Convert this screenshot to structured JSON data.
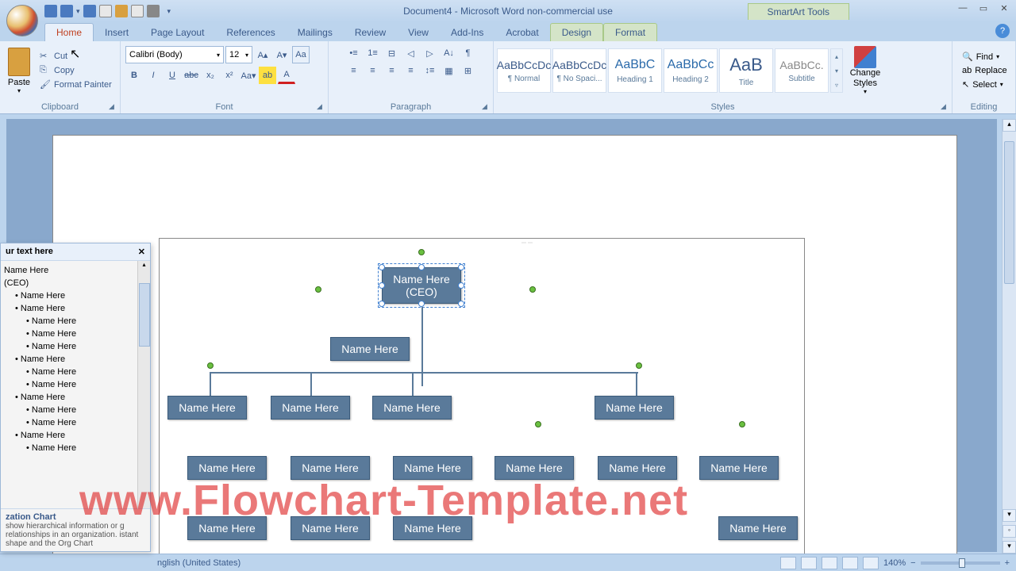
{
  "app": {
    "title": "Document4 - Microsoft Word non-commercial use",
    "contextual_tools": "SmartArt Tools"
  },
  "tabs": [
    "Home",
    "Insert",
    "Page Layout",
    "References",
    "Mailings",
    "Review",
    "View",
    "Add-Ins",
    "Acrobat",
    "Design",
    "Format"
  ],
  "active_tab": "Home",
  "clipboard": {
    "paste": "Paste",
    "cut": "Cut",
    "copy": "Copy",
    "format_painter": "Format Painter",
    "group": "Clipboard"
  },
  "font": {
    "name": "Calibri (Body)",
    "size": "12",
    "group": "Font"
  },
  "paragraph": {
    "group": "Paragraph"
  },
  "styles": {
    "items": [
      {
        "preview": "AaBbCcDc",
        "name": "¶ Normal"
      },
      {
        "preview": "AaBbCcDc",
        "name": "¶ No Spaci..."
      },
      {
        "preview": "AaBbC",
        "name": "Heading 1"
      },
      {
        "preview": "AaBbCc",
        "name": "Heading 2"
      },
      {
        "preview": "AaB",
        "name": "Title"
      },
      {
        "preview": "AaBbCc.",
        "name": "Subtitle"
      }
    ],
    "change": "Change Styles",
    "group": "Styles"
  },
  "editing": {
    "find": "Find",
    "replace": "Replace",
    "select": "Select",
    "group": "Editing"
  },
  "text_pane": {
    "title": "ur text here",
    "items": [
      {
        "t": "Name Here",
        "lvl": 0
      },
      {
        "t": "(CEO)",
        "lvl": 0
      },
      {
        "t": "Name Here",
        "lvl": 1
      },
      {
        "t": "Name Here",
        "lvl": 1
      },
      {
        "t": "Name Here",
        "lvl": 2
      },
      {
        "t": "Name Here",
        "lvl": 2
      },
      {
        "t": "Name Here",
        "lvl": 2
      },
      {
        "t": "Name Here",
        "lvl": 1
      },
      {
        "t": "Name Here",
        "lvl": 2
      },
      {
        "t": "Name Here",
        "lvl": 2
      },
      {
        "t": "Name Here",
        "lvl": 1
      },
      {
        "t": "Name Here",
        "lvl": 2
      },
      {
        "t": "Name Here",
        "lvl": 2
      },
      {
        "t": "Name Here",
        "lvl": 1
      },
      {
        "t": "Name Here",
        "lvl": 2
      }
    ],
    "footer_title": "zation Chart",
    "footer_text": "show hierarchical information or g relationships in an organization. istant shape and the Org Chart"
  },
  "org": {
    "ceo": "Name Here\n(CEO)",
    "assistant": "Name Here",
    "generic": "Name Here"
  },
  "watermark": "www.Flowchart-Template.net",
  "status": {
    "lang": "nglish (United States)",
    "zoom": "140%"
  }
}
